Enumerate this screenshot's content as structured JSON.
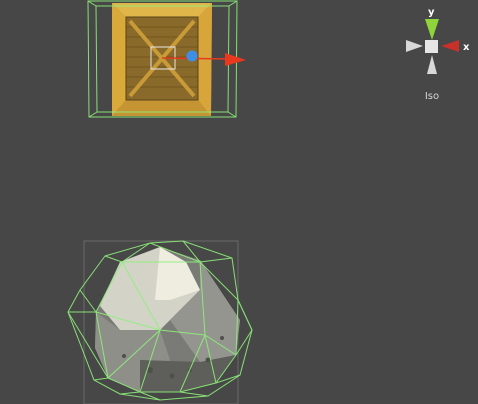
{
  "scene": {
    "background_color": "#474747",
    "collider_color": "#8ef07a",
    "crate_color": "#c99a34",
    "rock_color": "#bdbdb6"
  },
  "gizmo": {
    "axis_y_label": "y",
    "axis_x_label": "x",
    "projection_label": "Iso",
    "axis_y_color": "#8fd43a",
    "axis_x_color": "#c8302a",
    "axis_z_color": "#d8d8d8",
    "icons": [
      "axis-y-cone-icon",
      "axis-x-cone-icon",
      "axis-z-cone-icon",
      "center-cube-icon"
    ]
  },
  "transform_handle": {
    "x_arrow_color": "#e8391f",
    "center_color": "#3d8ee6",
    "icons": [
      "move-x-arrow-icon",
      "move-center-dot-icon",
      "move-plane-handle-icon"
    ]
  }
}
